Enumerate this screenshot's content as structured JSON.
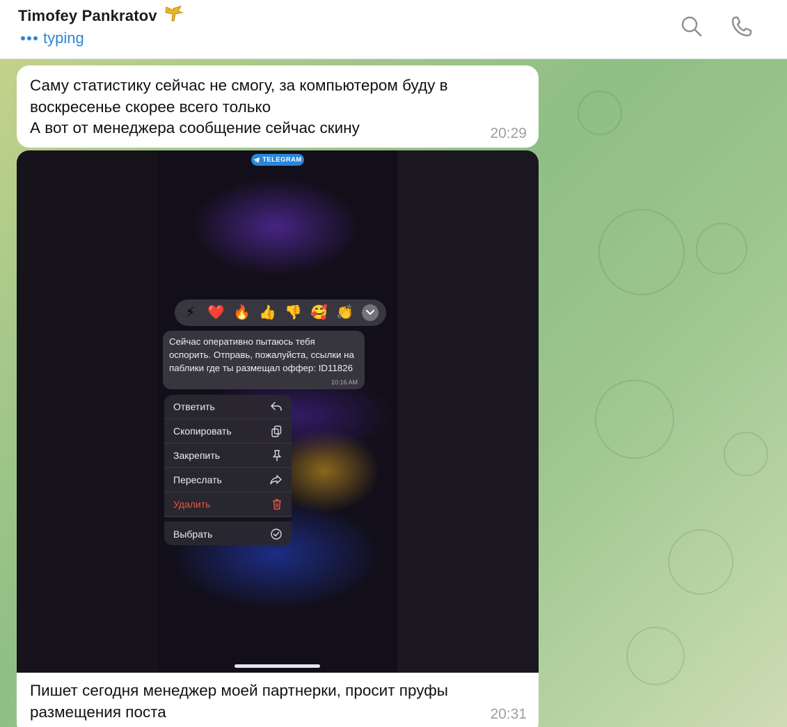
{
  "header": {
    "contact_name": "Timofey Pankratov",
    "status": "typing",
    "status_color": "#2a86d8",
    "search_icon": "search-icon",
    "call_icon": "phone-icon"
  },
  "messages": [
    {
      "text": "Саму статистику сейчас не смогу, за компьютером буду в\nвоскресенье скорее всего только\nА вот от менеджера сообщение сейчас скину",
      "time": "20:29"
    },
    {
      "text": "Пишет сегодня менеджер моей партнерки, просит пруфы\nразмещения поста",
      "time": "20:31"
    }
  ],
  "screenshot": {
    "badge": "TELEGRAM",
    "reactions": [
      "⚡",
      "❤️",
      "🔥",
      "👍",
      "👎",
      "🥰",
      "👏"
    ],
    "message_text": "Сейчас оперативно пытаюсь тебя оспорить. Отправь, пожалуйста, ссылки на паблики где ты размещал оффер: ID11826",
    "message_time": "10:16 AM",
    "menu": [
      {
        "label": "Ответить",
        "icon": "reply-icon"
      },
      {
        "label": "Скопировать",
        "icon": "copy-icon"
      },
      {
        "label": "Закрепить",
        "icon": "pin-icon"
      },
      {
        "label": "Переслать",
        "icon": "forward-icon"
      },
      {
        "label": "Удалить",
        "icon": "trash-icon",
        "danger_color": "#eb5545"
      },
      {
        "label": "Выбрать",
        "icon": "check-circle-icon"
      }
    ]
  }
}
